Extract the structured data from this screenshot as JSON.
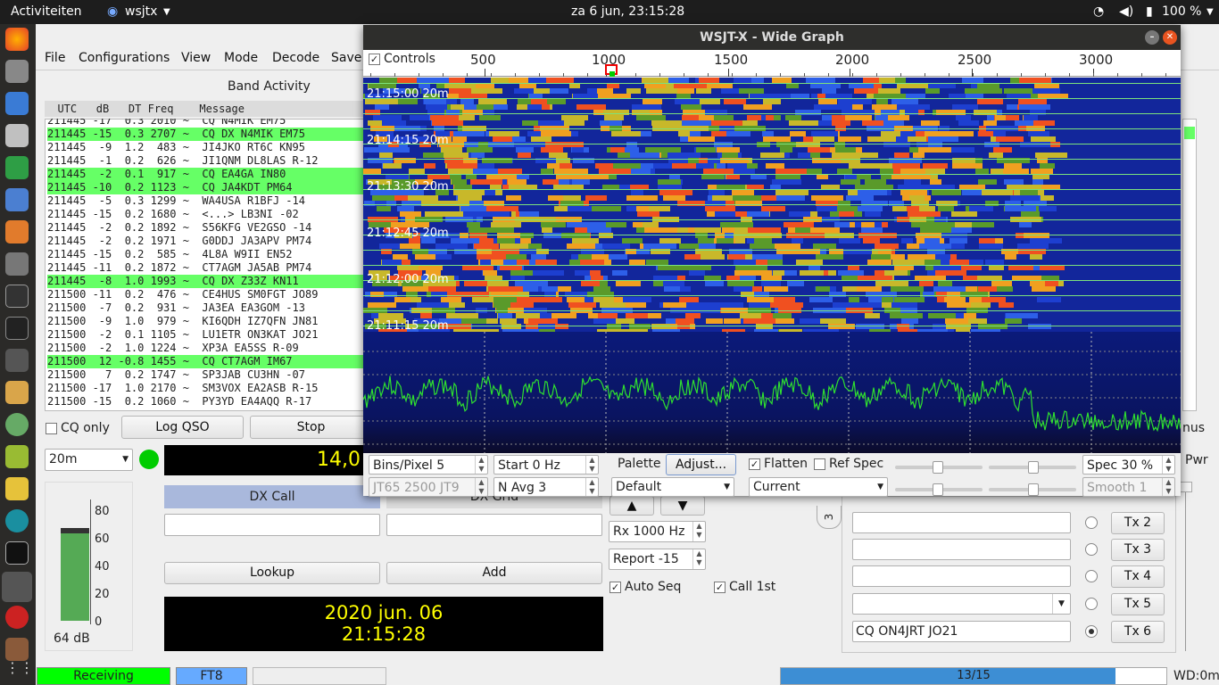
{
  "topbar": {
    "activities": "Activiteiten",
    "app": "wsjtx",
    "clock": "za  6 jun, 23:15:28",
    "battery": "100 %"
  },
  "menu": {
    "file": "File",
    "configurations": "Configurations",
    "view": "View",
    "mode": "Mode",
    "decode": "Decode",
    "save": "Save"
  },
  "band": {
    "title": "Band Activity",
    "header": "  UTC   dB   DT Freq    Message",
    "top_cut": "211445 -17  0.3 2010 ~  CQ N4MIK EM75",
    "rows": [
      {
        "text": "211445 -15  0.3 2707 ~  CQ DX N4MIK EM75",
        "hl": true
      },
      {
        "text": "211445  -9  1.2  483 ~  JI4JKO RT6C KN95",
        "hl": false
      },
      {
        "text": "211445  -1  0.2  626 ~  JI1QNM DL8LAS R-12",
        "hl": false
      },
      {
        "text": "211445  -2  0.1  917 ~  CQ EA4GA IN80",
        "hl": true
      },
      {
        "text": "211445 -10  0.2 1123 ~  CQ JA4KDT PM64",
        "hl": true
      },
      {
        "text": "211445  -5  0.3 1299 ~  WA4USA R1BFJ -14",
        "hl": false
      },
      {
        "text": "211445 -15  0.2 1680 ~  <...> LB3NI -02",
        "hl": false
      },
      {
        "text": "211445  -2  0.2 1892 ~  S56KFG VE2GSO -14",
        "hl": false
      },
      {
        "text": "211445  -2  0.2 1971 ~  G0DDJ JA3APV PM74",
        "hl": false
      },
      {
        "text": "211445 -15  0.2  585 ~  4L8A W9II EN52",
        "hl": false
      },
      {
        "text": "211445 -11  0.2 1872 ~  CT7AGM JA5AB PM74",
        "hl": false
      },
      {
        "text": "211445  -8  1.0 1993 ~  CQ DX Z33Z KN11",
        "hl": true
      },
      {
        "text": "211500 -11  0.2  476 ~  CE4HUS SM0FGT JO89",
        "hl": false
      },
      {
        "text": "211500  -7  0.2  931 ~  JA3EA EA3GOM -13",
        "hl": false
      },
      {
        "text": "211500  -9  1.0  979 ~  KI6QDH IZ7QFN JN81",
        "hl": false
      },
      {
        "text": "211500  -2  0.1 1105 ~  LU1ETR ON3KAT JO21",
        "hl": false
      },
      {
        "text": "211500  -2  1.0 1224 ~  XP3A EA5SS R-09",
        "hl": false
      },
      {
        "text": "211500  12 -0.8 1455 ~  CQ CT7AGM IM67",
        "hl": true
      },
      {
        "text": "211500   7  0.2 1747 ~  SP3JAB CU3HN -07",
        "hl": false
      },
      {
        "text": "211500 -17  1.0 2170 ~  SM3VOX EA2ASB R-15",
        "hl": false
      },
      {
        "text": "211500 -15  0.2 1060 ~  PY3YD EA4AQQ R-17",
        "hl": false
      }
    ]
  },
  "controls": {
    "cq_only": "CQ only",
    "log_qso": "Log QSO",
    "stop": "Stop",
    "band": "20m",
    "freq": "14,0",
    "dx_call": "DX Call",
    "dx_grid": "DX Grid",
    "lookup": "Lookup",
    "add": "Add",
    "date": "2020 jun. 06",
    "time": "21:15:28",
    "menus_cut": "nus",
    "pwr": "Pwr"
  },
  "meter": {
    "ticks": [
      "80",
      "60",
      "40",
      "20",
      "0"
    ],
    "value_label": "64 dB",
    "level_db": 64
  },
  "tx": {
    "tab": "3",
    "rx_label": "Rx  1000  Hz",
    "report": "Report -15",
    "auto_seq": "Auto Seq",
    "call_1st": "Call 1st",
    "up": "▲",
    "down": "▼",
    "buttons": [
      "Tx 2",
      "Tx 3",
      "Tx 4",
      "Tx 5",
      "Tx 6"
    ],
    "tx6_msg": "CQ ON4JRT JO21"
  },
  "status": {
    "receiving": "Receiving",
    "mode": "FT8",
    "progress": "13/15",
    "progress_frac": 0.867,
    "wd": "WD:0m"
  },
  "wide_graph": {
    "title": "WSJT-X - Wide Graph",
    "controls": "Controls",
    "scale": [
      "500",
      "1000",
      "1500",
      "2000",
      "2500",
      "3000"
    ],
    "times": [
      "21:15:00  20m",
      "21:14:15  20m",
      "21:13:30  20m",
      "21:12:45  20m",
      "21:12:00  20m",
      "21:11:15  20m"
    ],
    "bins": "Bins/Pixel  5",
    "start": "Start 0 Hz",
    "palette": "Palette",
    "adjust": "Adjust...",
    "flatten": "Flatten",
    "ref_spec": "Ref Spec",
    "spec": "Spec 30 %",
    "jt": "JT65  2500  JT9",
    "navg": "N Avg 3",
    "palette_sel": "Default",
    "current": "Current",
    "smooth": "Smooth  1"
  }
}
